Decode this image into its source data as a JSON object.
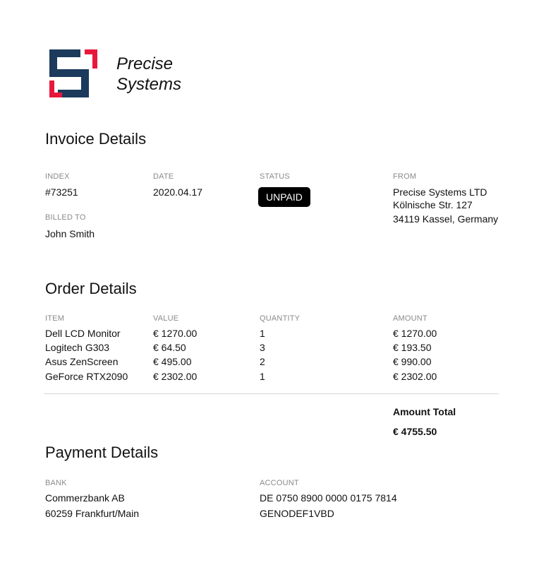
{
  "brand": {
    "name_line1": "Precise",
    "name_line2": "Systems",
    "logo_icon": "brand-s-bracket-logo",
    "colors": {
      "navy": "#1b3a5c",
      "red": "#e8183c"
    }
  },
  "invoice": {
    "heading": "Invoice Details",
    "index_label": "INDEX",
    "index_value": "#73251",
    "date_label": "DATE",
    "date_value": "2020.04.17",
    "status_label": "STATUS",
    "status_value": "UNPAID",
    "from_label": "FROM",
    "from_line1": "Precise Systems LTD",
    "from_line2": "Kölnische Str. 127",
    "from_line3": "34119 Kassel, Germany",
    "billed_label": "BILLED TO",
    "billed_value": "John Smith"
  },
  "order": {
    "heading": "Order Details",
    "columns": [
      "ITEM",
      "VALUE",
      "QUANTITY",
      "AMOUNT"
    ],
    "rows": [
      {
        "item": "Dell LCD Monitor",
        "value": "€ 1270.00",
        "quantity": "1",
        "amount": "€ 1270.00"
      },
      {
        "item": "Logitech G303",
        "value": "€ 64.50",
        "quantity": "3",
        "amount": "€ 193.50"
      },
      {
        "item": "Asus ZenScreen",
        "value": "€ 495.00",
        "quantity": "2",
        "amount": "€ 990.00"
      },
      {
        "item": "GeForce RTX2090",
        "value": "€ 2302.00",
        "quantity": "1",
        "amount": "€ 2302.00"
      }
    ],
    "total_label": "Amount Total",
    "total_value": "€ 4755.50"
  },
  "payment": {
    "heading": "Payment Details",
    "bank_label": "BANK",
    "bank_line1": "Commerzbank AB",
    "bank_line2": "60259 Frankfurt/Main",
    "account_label": "ACCOUNT",
    "account_line1": "DE 0750 8900 0000 0175 7814",
    "account_line2": "GENODEF1VBD"
  }
}
